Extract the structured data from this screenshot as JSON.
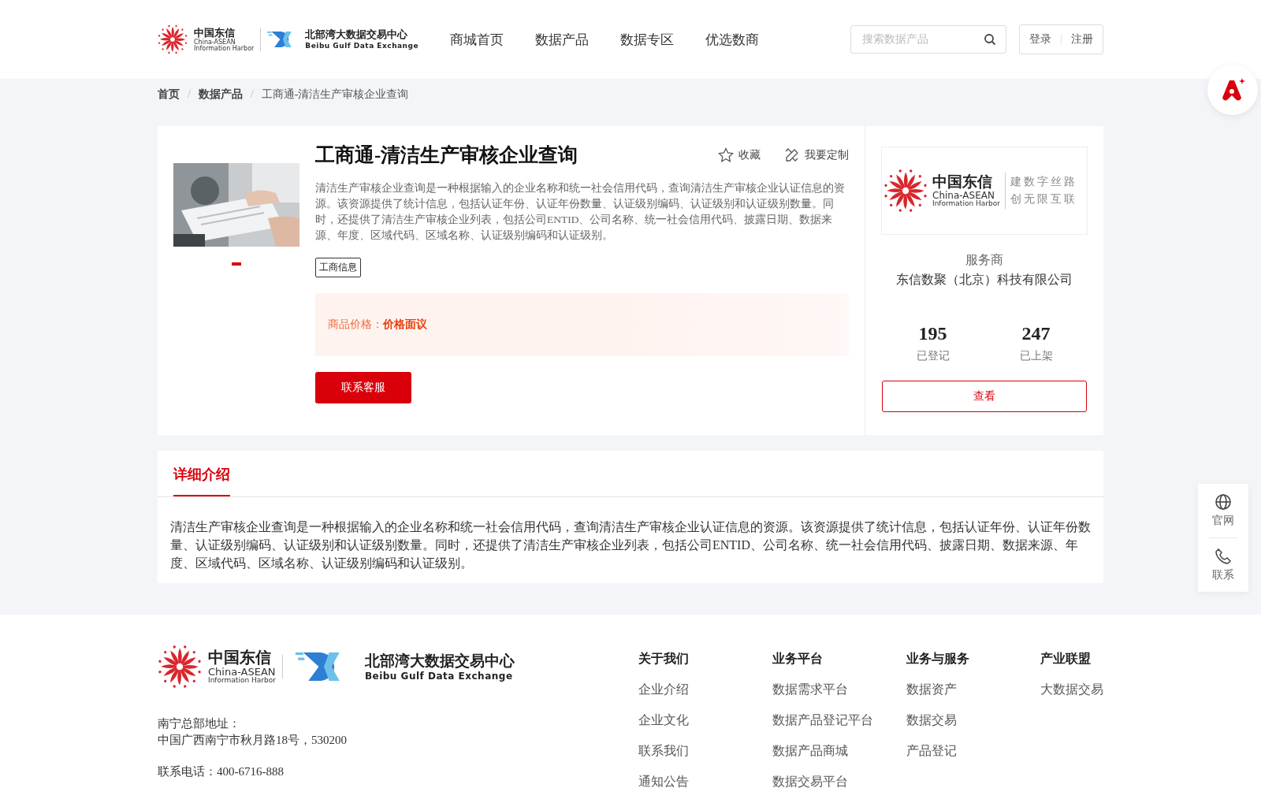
{
  "header": {
    "logo": {
      "cn": "中国东信",
      "en1": "China-ASEAN",
      "en2": "Information Harbor",
      "bg_cn": "北部湾大数据交易中心",
      "bg_en": "Beibu Gulf Data Exchange"
    },
    "nav": [
      {
        "label": "商城首页"
      },
      {
        "label": "数据产品"
      },
      {
        "label": "数据专区"
      },
      {
        "label": "优选数商"
      }
    ],
    "search": {
      "placeholder": "搜索数据产品"
    },
    "login": "登录",
    "register": "注册"
  },
  "breadcrumb": {
    "separator": "/",
    "items": [
      "首页",
      "数据产品",
      "工商通-清洁生产审核企业查询"
    ]
  },
  "product": {
    "title": "工商通-清洁生产审核企业查询",
    "actions": [
      {
        "kind": "star",
        "label": "收藏"
      },
      {
        "kind": "custom",
        "label": "我要定制"
      }
    ],
    "description": "清洁生产审核企业查询是一种根据输入的企业名称和统一社会信用代码，查询清洁生产审核企业认证信息的资源。该资源提供了统计信息，包括认证年份、认证年份数量、认证级别编码、认证级别和认证级别数量。同时，还提供了清洁生产审核企业列表，包括公司ENTID、公司名称、统一社会信用代码、披露日期、数据来源、年度、区域代码、区域名称、认证级别编码和认证级别。",
    "tags": [
      "工商信息"
    ],
    "price_label": "商品价格：",
    "price": "价格面议",
    "contact_button": "联系客服",
    "carousel": [
      {
        "selected": true
      }
    ]
  },
  "provider": {
    "logo": {
      "cn": "中国东信",
      "en1": "China-ASEAN",
      "en2": "Information Harbor",
      "slogan1": "建数字丝路",
      "slogan2": "创无限互联"
    },
    "label": "服务商",
    "name": "东信数聚（北京）科技有限公司",
    "stats": [
      {
        "value": "195",
        "label": "已登记"
      },
      {
        "value": "247",
        "label": "已上架"
      }
    ],
    "view_button": "查看"
  },
  "detail": {
    "tabs": [
      {
        "label": "详细介绍",
        "selected": true
      }
    ],
    "text": "清洁生产审核企业查询是一种根据输入的企业名称和统一社会信用代码，查询清洁生产审核企业认证信息的资源。该资源提供了统计信息，包括认证年份、认证年份数量、认证级别编码、认证级别和认证级别数量。同时，还提供了清洁生产审核企业列表，包括公司ENTID、公司名称、统一社会信用代码、披露日期、数据来源、年度、区域代码、区域名称、认证级别编码和认证级别。"
  },
  "side_tools": [
    {
      "kind": "globe",
      "label": "官网"
    },
    {
      "kind": "phone",
      "label": "联系"
    }
  ],
  "footer": {
    "logo": {
      "cn": "中国东信",
      "en1": "China-ASEAN",
      "en2": "Information Harbor",
      "bg_cn": "北部湾大数据交易中心",
      "bg_en": "Beibu Gulf Data Exchange"
    },
    "address_label": "南宁总部地址：",
    "address": "中国广西南宁市秋月路18号，530200",
    "phone": "联系电话：400-6716-888",
    "columns": [
      {
        "title": "关于我们",
        "links": [
          "企业介绍",
          "企业文化",
          "联系我们",
          "通知公告"
        ]
      },
      {
        "title": "业务平台",
        "links": [
          "数据需求平台",
          "数据产品登记平台",
          "数据产品商城",
          "数据交易平台"
        ]
      },
      {
        "title": "业务与服务",
        "links": [
          "数据资产",
          "数据交易",
          "产品登记"
        ]
      },
      {
        "title": "产业联盟",
        "links": [
          "大数据交易"
        ]
      }
    ]
  }
}
